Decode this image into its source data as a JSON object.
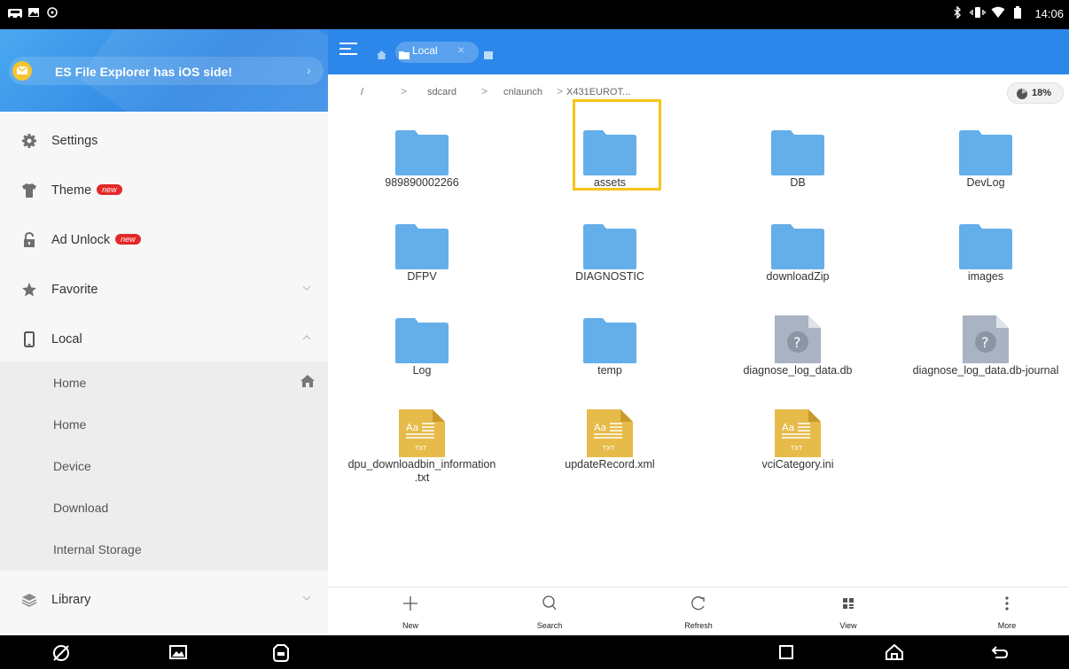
{
  "status_bar": {
    "time": "14:06",
    "icons": [
      "incar-icon",
      "image-icon",
      "alarm-icon",
      "bluetooth-icon",
      "vibrate-icon",
      "wifi-icon",
      "battery-icon"
    ]
  },
  "drawer": {
    "banner_text": "ES File Explorer has iOS side!",
    "items": [
      {
        "label": "Settings",
        "icon": "gear-icon"
      },
      {
        "label": "Theme",
        "icon": "shirt-icon",
        "badge": "new"
      },
      {
        "label": "Ad Unlock",
        "icon": "lock-icon",
        "badge": "new"
      },
      {
        "label": "Favorite",
        "icon": "star-icon"
      },
      {
        "label": "Local",
        "icon": "phone-icon"
      },
      {
        "label": "Library",
        "icon": "layers-icon"
      }
    ],
    "local_children": [
      {
        "label": "Home"
      },
      {
        "label": "Home"
      },
      {
        "label": "Device"
      },
      {
        "label": "Download"
      },
      {
        "label": "Internal Storage"
      }
    ]
  },
  "topbar": {
    "tab_label": "Local",
    "tab_close": "×"
  },
  "path": {
    "root": "/",
    "segments": [
      "sdcard",
      "cnlaunch",
      "X431EUROT..."
    ],
    "storage": "18%",
    "storage_fraction": 0.18
  },
  "files": [
    {
      "name": "989890002266",
      "type": "folder"
    },
    {
      "name": "assets",
      "type": "folder",
      "selected": true
    },
    {
      "name": "DB",
      "type": "folder"
    },
    {
      "name": "DevLog",
      "type": "folder"
    },
    {
      "name": "DFPV",
      "type": "folder"
    },
    {
      "name": "DIAGNOSTIC",
      "type": "folder"
    },
    {
      "name": "downloadZip",
      "type": "folder"
    },
    {
      "name": "images",
      "type": "folder"
    },
    {
      "name": "Log",
      "type": "folder"
    },
    {
      "name": "temp",
      "type": "folder"
    },
    {
      "name": "diagnose_log_data.db",
      "type": "unknown"
    },
    {
      "name": "diagnose_log_data.db-journal",
      "type": "unknown"
    },
    {
      "name": "dpu_downloadbin_information\n.txt",
      "type": "text"
    },
    {
      "name": "updateRecord.xml",
      "type": "text"
    },
    {
      "name": "vciCategory.ini",
      "type": "text"
    }
  ],
  "toolbar": {
    "new": "New",
    "search": "Search",
    "refresh": "Refresh",
    "view": "View",
    "more": "More"
  },
  "colors": {
    "accent": "#2b87ea",
    "folder": "#64aeea",
    "text_file": "#e6bb4a",
    "unknown_file": "#a9b3c2",
    "selection": "#f5c518",
    "badge": "#e42828"
  }
}
